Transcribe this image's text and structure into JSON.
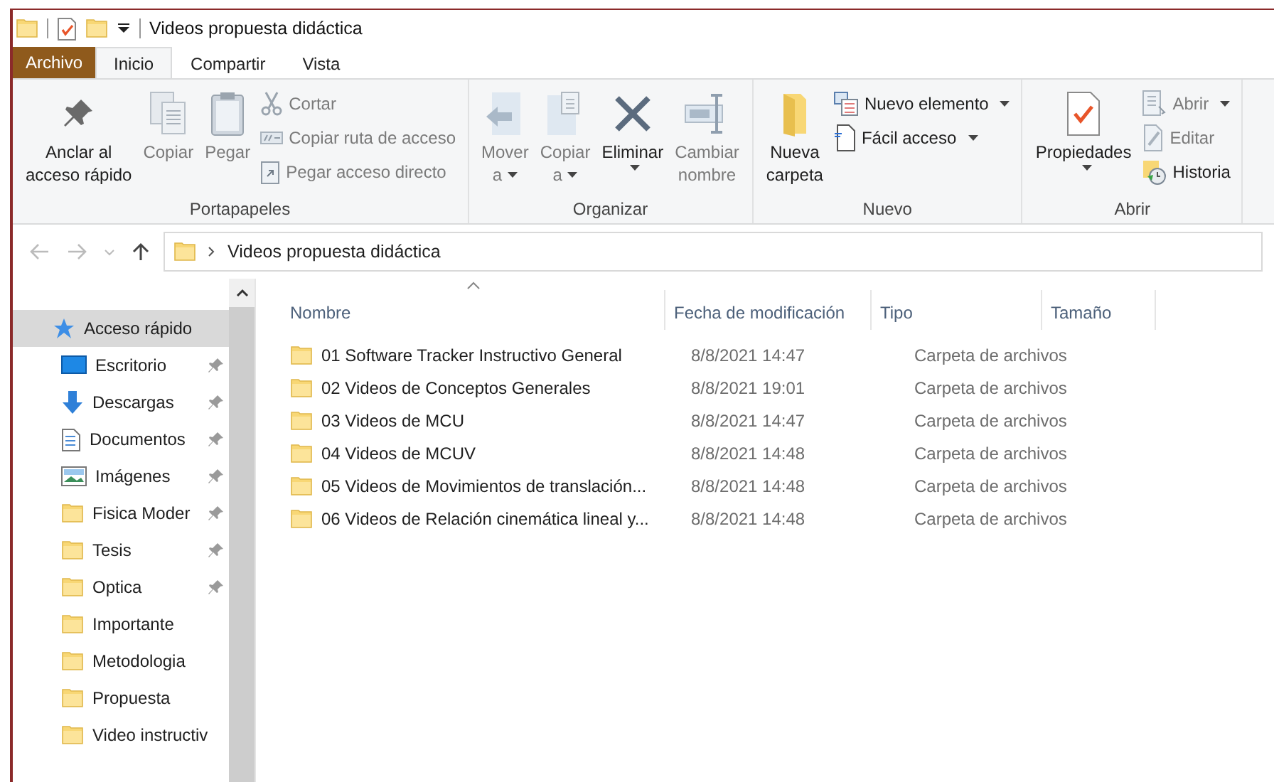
{
  "window": {
    "title": "Videos propuesta didáctica"
  },
  "tabs": [
    {
      "label": "Archivo",
      "kind": "file",
      "selected": false
    },
    {
      "label": "Inicio",
      "kind": "tab",
      "selected": true
    },
    {
      "label": "Compartir",
      "kind": "tab",
      "selected": false
    },
    {
      "label": "Vista",
      "kind": "tab",
      "selected": false
    }
  ],
  "ribbon": {
    "groups": [
      {
        "label": "Portapapeles",
        "items": [
          {
            "kind": "large",
            "lines": [
              "Anclar al",
              "acceso rápido"
            ],
            "disabled": false,
            "dropdown": false
          },
          {
            "kind": "large",
            "lines": [
              "Copiar"
            ],
            "disabled": true,
            "dropdown": false
          },
          {
            "kind": "large",
            "lines": [
              "Pegar"
            ],
            "disabled": true,
            "dropdown": false
          },
          {
            "kind": "small",
            "lines": [
              "Cortar"
            ],
            "disabled": true,
            "dropdown": false
          },
          {
            "kind": "small",
            "lines": [
              "Copiar ruta de acceso"
            ],
            "disabled": true,
            "dropdown": false
          },
          {
            "kind": "small",
            "lines": [
              "Pegar acceso directo"
            ],
            "disabled": true,
            "dropdown": false
          }
        ]
      },
      {
        "label": "Organizar",
        "items": [
          {
            "kind": "large",
            "lines": [
              "Mover",
              "a"
            ],
            "disabled": true,
            "dropdown": true
          },
          {
            "kind": "large",
            "lines": [
              "Copiar",
              "a"
            ],
            "disabled": true,
            "dropdown": true
          },
          {
            "kind": "large",
            "lines": [
              "Eliminar"
            ],
            "disabled": false,
            "dropdown": true
          },
          {
            "kind": "large",
            "lines": [
              "Cambiar",
              "nombre"
            ],
            "disabled": true,
            "dropdown": false
          }
        ]
      },
      {
        "label": "Nuevo",
        "items": [
          {
            "kind": "large",
            "lines": [
              "Nueva",
              "carpeta"
            ],
            "disabled": false,
            "dropdown": false
          },
          {
            "kind": "small",
            "lines": [
              "Nuevo elemento"
            ],
            "disabled": false,
            "dropdown": true
          },
          {
            "kind": "small",
            "lines": [
              "Fácil acceso"
            ],
            "disabled": false,
            "dropdown": true
          }
        ]
      },
      {
        "label": "Abrir",
        "items": [
          {
            "kind": "large",
            "lines": [
              "Propiedades"
            ],
            "disabled": false,
            "dropdown": true
          },
          {
            "kind": "small",
            "lines": [
              "Abrir"
            ],
            "disabled": true,
            "dropdown": true
          },
          {
            "kind": "small",
            "lines": [
              "Editar"
            ],
            "disabled": true,
            "dropdown": false
          },
          {
            "kind": "small",
            "lines": [
              "Historia"
            ],
            "disabled": false,
            "dropdown": false
          }
        ]
      }
    ]
  },
  "address_bar": {
    "path": "Videos propuesta didáctica"
  },
  "nav_pane": {
    "items": [
      {
        "label": "Acceso rápido",
        "kind": "quick",
        "pinned": false,
        "selected": true
      },
      {
        "label": "Escritorio",
        "kind": "desktop",
        "pinned": true,
        "selected": false
      },
      {
        "label": "Descargas",
        "kind": "downloads",
        "pinned": true,
        "selected": false
      },
      {
        "label": "Documentos",
        "kind": "documents",
        "pinned": true,
        "selected": false
      },
      {
        "label": "Imágenes",
        "kind": "pictures",
        "pinned": true,
        "selected": false
      },
      {
        "label": "Fisica Moder",
        "kind": "folder",
        "pinned": true,
        "selected": false
      },
      {
        "label": "Tesis",
        "kind": "folder",
        "pinned": true,
        "selected": false
      },
      {
        "label": "Optica",
        "kind": "folder",
        "pinned": true,
        "selected": false
      },
      {
        "label": "Importante",
        "kind": "folder",
        "pinned": false,
        "selected": false
      },
      {
        "label": "Metodologia",
        "kind": "folder",
        "pinned": false,
        "selected": false
      },
      {
        "label": "Propuesta",
        "kind": "folder",
        "pinned": false,
        "selected": false
      },
      {
        "label": "Video instructiv",
        "kind": "folder",
        "pinned": false,
        "selected": false
      }
    ]
  },
  "file_list": {
    "columns": [
      "Nombre",
      "Fecha de modificación",
      "Tipo",
      "Tamaño"
    ],
    "rows": [
      {
        "name": "01 Software Tracker Instructivo General",
        "date": "8/8/2021 14:47",
        "type": "Carpeta de archivos"
      },
      {
        "name": "02 Videos de Conceptos Generales",
        "date": "8/8/2021 19:01",
        "type": "Carpeta de archivos"
      },
      {
        "name": "03 Videos de  MCU",
        "date": "8/8/2021 14:47",
        "type": "Carpeta de archivos"
      },
      {
        "name": "04 Videos de MCUV",
        "date": "8/8/2021 14:48",
        "type": "Carpeta de archivos"
      },
      {
        "name": "05 Videos de Movimientos de translación...",
        "date": "8/8/2021 14:48",
        "type": "Carpeta de archivos"
      },
      {
        "name": "06 Videos de Relación cinemática lineal y...",
        "date": "8/8/2021 14:48",
        "type": "Carpeta de archivos"
      }
    ]
  }
}
